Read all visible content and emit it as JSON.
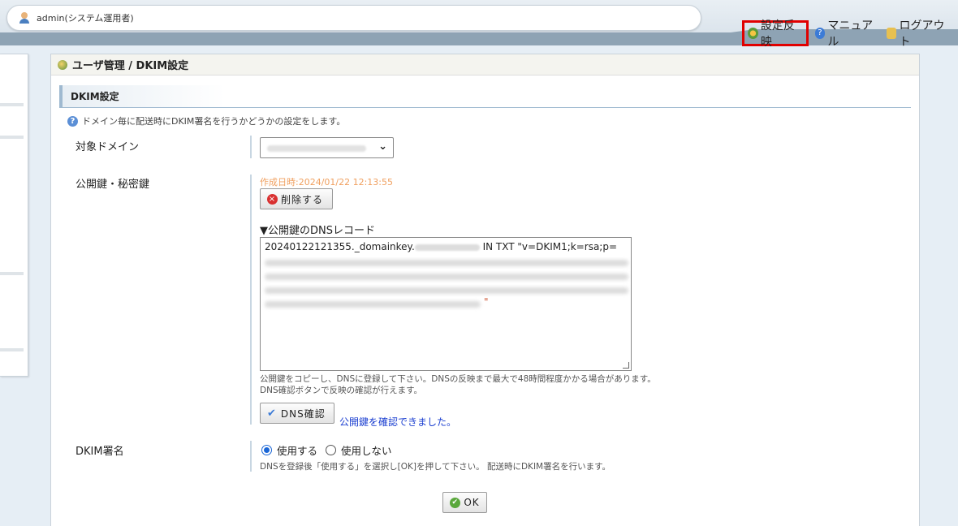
{
  "header": {
    "user": "admin(システム運用者)",
    "links": {
      "reflect": "設定反映",
      "manual": "マニュアル",
      "logout": "ログアウト"
    }
  },
  "breadcrumb": "ユーザ管理 / DKIM設定",
  "section": {
    "title": "DKIM設定",
    "description": "ドメイン毎に配送時にDKIM署名を行うかどうかの設定をします。"
  },
  "form": {
    "domain": {
      "label": "対象ドメイン"
    },
    "keys": {
      "label": "公開鍵・秘密鍵",
      "created": "作成日時:2024/01/22 12:13:55",
      "delete_button": "削除する",
      "dns_record_heading": "▼公開鍵のDNSレコード",
      "dns_record_prefix": "20240122121355._domainkey.",
      "dns_record_suffix": "IN    TXT   \"v=DKIM1;k=rsa;p=",
      "dns_record_end": "\"",
      "note_line1": "公開鍵をコピーし、DNSに登録して下さい。DNSの反映まで最大で48時間程度かかる場合があります。",
      "note_line2": "DNS確認ボタンで反映の確認が行えます。",
      "dns_check_button": "DNS確認",
      "dns_check_result": "公開鍵を確認できました。"
    },
    "dkim_sign": {
      "label": "DKIM署名",
      "option_use": "使用する",
      "option_not_use": "使用しない",
      "selected": "use",
      "note": "DNSを登録後「使用する」を選択し[OK]を押して下さい。 配送時にDKIM署名を行います。"
    },
    "ok_button": "OK"
  }
}
